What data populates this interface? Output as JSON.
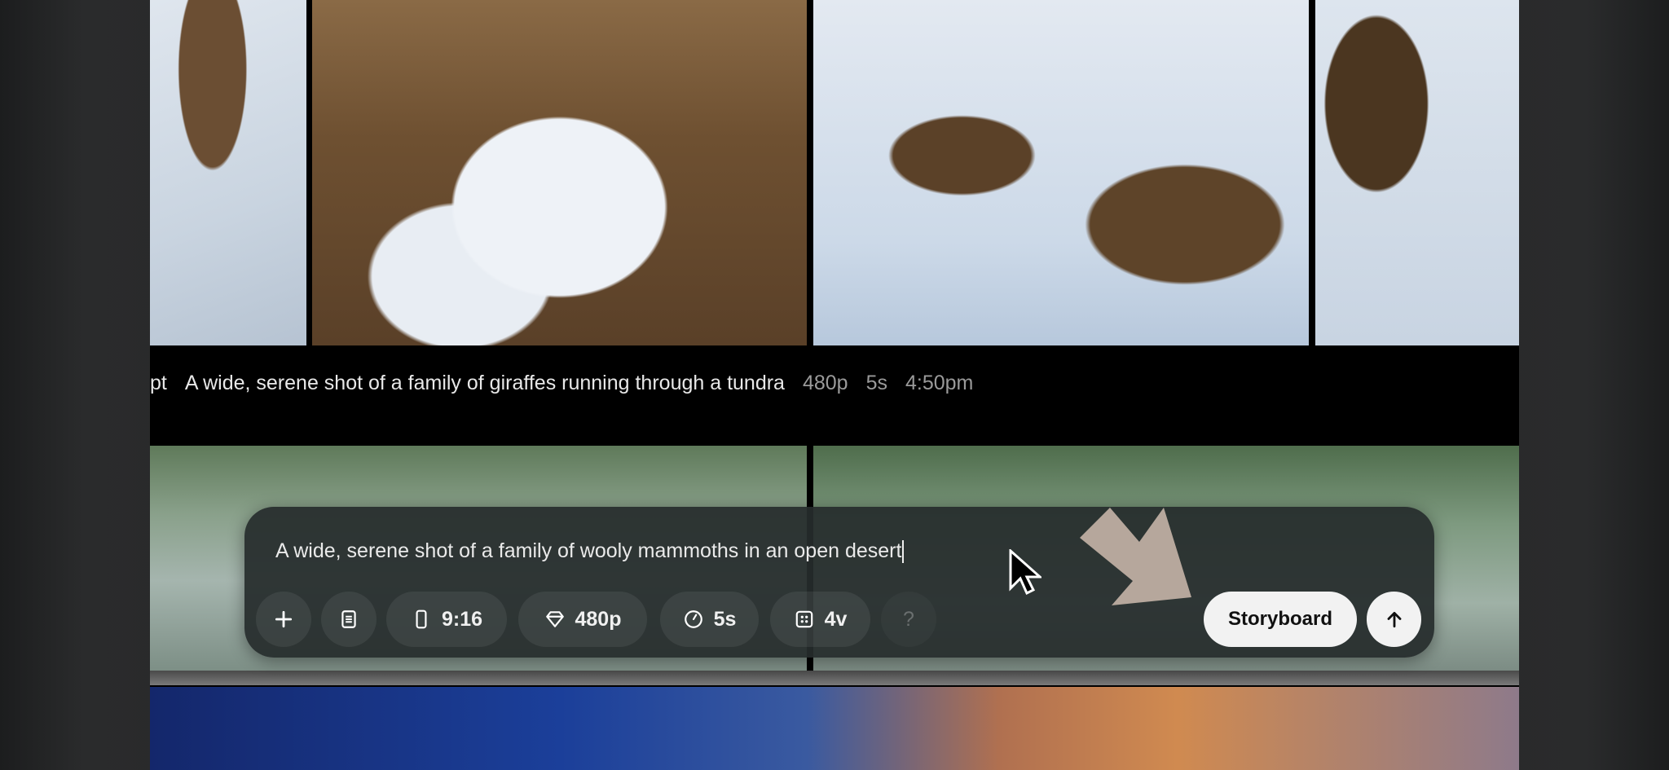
{
  "gallery": {
    "item": {
      "prefix": "pt",
      "prompt": "A wide, serene shot of a family of giraffes running through a tundra",
      "resolution": "480p",
      "duration": "5s",
      "time": "4:50pm"
    }
  },
  "composer": {
    "prompt": "A wide, serene shot of a family of wooly mammoths in an open desert",
    "aspect_ratio": "9:16",
    "resolution": "480p",
    "duration": "5s",
    "variations": "4v",
    "help": "?",
    "storyboard_label": "Storyboard"
  },
  "colors": {
    "annotation_arrow": "#b6a79c",
    "panel": "#262c2c"
  }
}
